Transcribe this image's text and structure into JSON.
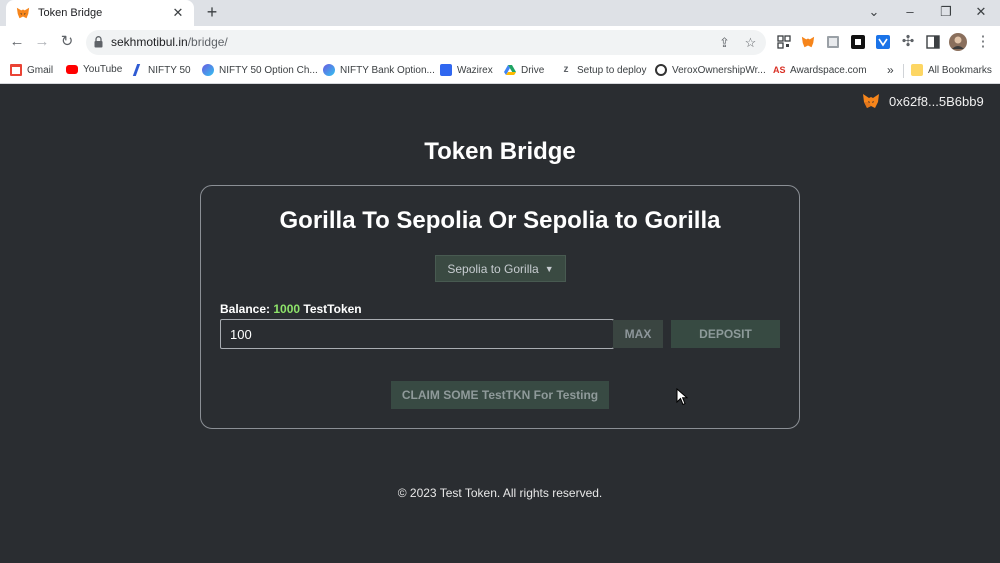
{
  "browser": {
    "tab_title": "Token Bridge",
    "tab_close": "✕",
    "new_tab": "+",
    "win_controls": [
      "⌄",
      "–",
      "❐",
      "✕"
    ],
    "url_host": "sekhmotibul.in",
    "url_path": "/bridge/",
    "bookmarks": [
      {
        "label": "Gmail",
        "color": "#ea4335"
      },
      {
        "label": "YouTube",
        "color": "#ff0000"
      },
      {
        "label": "NIFTY 50",
        "color": "#2f5bd3"
      },
      {
        "label": "NIFTY 50 Option Ch...",
        "color": "#6a5ae0"
      },
      {
        "label": "NIFTY Bank Option...",
        "color": "#6a5ae0"
      },
      {
        "label": "Wazirex",
        "color": "#3067f0"
      },
      {
        "label": "Drive",
        "color": "#1fa463"
      },
      {
        "label": "Setup to deploy",
        "color": "#5f6368"
      },
      {
        "label": "VeroxOwnershipWr...",
        "color": "#333333"
      },
      {
        "label": "Awardspace.com",
        "color": "#d93025"
      }
    ],
    "bookmarks_more": "»",
    "all_bookmarks": "All Bookmarks"
  },
  "wallet": {
    "address": "0x62f8...5B6bb9"
  },
  "page": {
    "title": "Token Bridge",
    "card_title": "Gorilla To Sepolia Or Sepolia to Gorilla",
    "direction_selected": "Sepolia to Gorilla",
    "balance_label": "Balance: ",
    "balance_amount": "1000",
    "balance_unit": " TestToken",
    "amount_value": "100",
    "max_label": "MAX",
    "deposit_label": "DEPOSIT",
    "claim_label": "CLAIM SOME TestTKN For Testing",
    "footer": "© 2023 Test Token. All rights reserved."
  },
  "colors": {
    "page_bg": "#2a2d31",
    "balance_accent": "#8ee36a",
    "button_bg": "#374a42"
  }
}
